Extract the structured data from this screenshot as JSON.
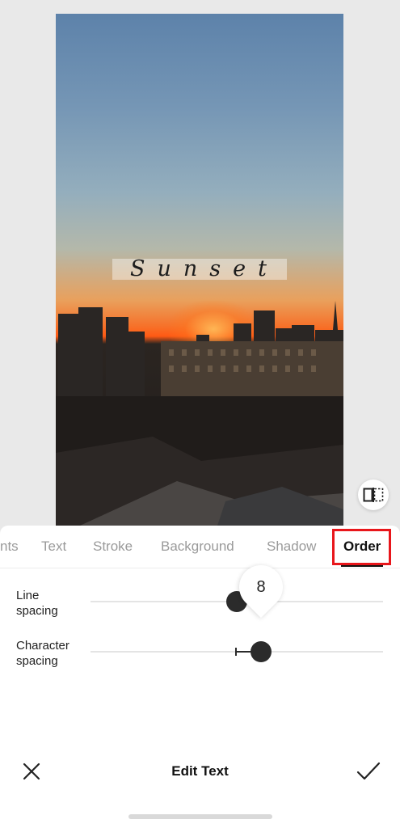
{
  "canvas": {
    "overlay_text": "Sunset"
  },
  "tabs": [
    {
      "label": "nts"
    },
    {
      "label": "Text"
    },
    {
      "label": "Stroke"
    },
    {
      "label": "Background"
    },
    {
      "label": "Shadow"
    },
    {
      "label": "Order",
      "active": true
    }
  ],
  "sliders": {
    "line_spacing": {
      "label_line1": "Line",
      "label_line2": "spacing",
      "value": "8"
    },
    "character_spacing": {
      "label_line1": "Character",
      "label_line2": "spacing"
    }
  },
  "bottom_bar": {
    "title": "Edit Text"
  },
  "colors": {
    "highlight": "#e8161b",
    "active_tab": "#111111",
    "inactive_tab": "#9a9a9a",
    "knob": "#2b2b2b"
  },
  "icons": {
    "compare": "compare-icon",
    "close": "close-icon",
    "confirm": "checkmark-icon"
  }
}
